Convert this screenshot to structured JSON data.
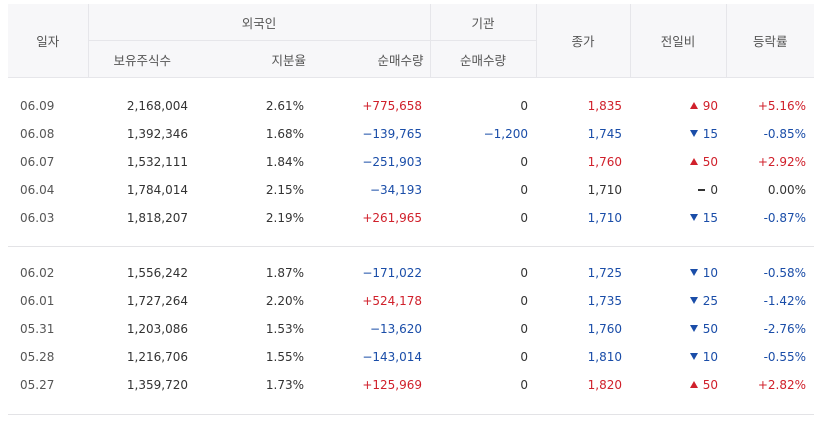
{
  "header": {
    "date": "일자",
    "foreign": "외국인",
    "institution": "기관",
    "close": "종가",
    "change": "전일비",
    "rate": "등락률",
    "holdings": "보유주식수",
    "ratio": "지분율",
    "foreign_net": "순매수량",
    "inst_net": "순매수량"
  },
  "groups": [
    {
      "rows": [
        {
          "date": "06.09",
          "holdings": "2,168,004",
          "ratio": "2.61%",
          "foreign_net": "+775,658",
          "foreign_dir": "up",
          "inst_net": "0",
          "close": "1,835",
          "close_dir": "up",
          "change": "90",
          "change_dir": "up",
          "rate": "+5.16%",
          "rate_dir": "up"
        },
        {
          "date": "06.08",
          "holdings": "1,392,346",
          "ratio": "1.68%",
          "foreign_net": "−139,765",
          "foreign_dir": "down",
          "inst_net": "−1,200",
          "inst_dir": "down",
          "close": "1,745",
          "close_dir": "down",
          "change": "15",
          "change_dir": "down",
          "rate": "-0.85%",
          "rate_dir": "down"
        },
        {
          "date": "06.07",
          "holdings": "1,532,111",
          "ratio": "1.84%",
          "foreign_net": "−251,903",
          "foreign_dir": "down",
          "inst_net": "0",
          "close": "1,760",
          "close_dir": "up",
          "change": "50",
          "change_dir": "up",
          "rate": "+2.92%",
          "rate_dir": "up"
        },
        {
          "date": "06.04",
          "holdings": "1,784,014",
          "ratio": "2.15%",
          "foreign_net": "−34,193",
          "foreign_dir": "down",
          "inst_net": "0",
          "close": "1,710",
          "close_dir": "flat",
          "change": "0",
          "change_dir": "flat",
          "rate": "0.00%",
          "rate_dir": "flat"
        },
        {
          "date": "06.03",
          "holdings": "1,818,207",
          "ratio": "2.19%",
          "foreign_net": "+261,965",
          "foreign_dir": "up",
          "inst_net": "0",
          "close": "1,710",
          "close_dir": "down",
          "change": "15",
          "change_dir": "down",
          "rate": "-0.87%",
          "rate_dir": "down"
        }
      ]
    },
    {
      "rows": [
        {
          "date": "06.02",
          "holdings": "1,556,242",
          "ratio": "1.87%",
          "foreign_net": "−171,022",
          "foreign_dir": "down",
          "inst_net": "0",
          "close": "1,725",
          "close_dir": "down",
          "change": "10",
          "change_dir": "down",
          "rate": "-0.58%",
          "rate_dir": "down"
        },
        {
          "date": "06.01",
          "holdings": "1,727,264",
          "ratio": "2.20%",
          "foreign_net": "+524,178",
          "foreign_dir": "up",
          "inst_net": "0",
          "close": "1,735",
          "close_dir": "down",
          "change": "25",
          "change_dir": "down",
          "rate": "-1.42%",
          "rate_dir": "down"
        },
        {
          "date": "05.31",
          "holdings": "1,203,086",
          "ratio": "1.53%",
          "foreign_net": "−13,620",
          "foreign_dir": "down",
          "inst_net": "0",
          "close": "1,760",
          "close_dir": "down",
          "change": "50",
          "change_dir": "down",
          "rate": "-2.76%",
          "rate_dir": "down"
        },
        {
          "date": "05.28",
          "holdings": "1,216,706",
          "ratio": "1.55%",
          "foreign_net": "−143,014",
          "foreign_dir": "down",
          "inst_net": "0",
          "close": "1,810",
          "close_dir": "down",
          "change": "10",
          "change_dir": "down",
          "rate": "-0.55%",
          "rate_dir": "down"
        },
        {
          "date": "05.27",
          "holdings": "1,359,720",
          "ratio": "1.73%",
          "foreign_net": "+125,969",
          "foreign_dir": "up",
          "inst_net": "0",
          "close": "1,820",
          "close_dir": "up",
          "change": "50",
          "change_dir": "up",
          "rate": "+2.82%",
          "rate_dir": "up"
        }
      ]
    }
  ],
  "colors": {
    "up": "#d0202b",
    "down": "#1a4da8",
    "flat": "#333333",
    "header_bg": "#f7f7f9",
    "line": "#e3e3e6"
  },
  "icons": {
    "up": "triangle-up-icon",
    "down": "triangle-down-icon",
    "flat": "dash-icon"
  }
}
